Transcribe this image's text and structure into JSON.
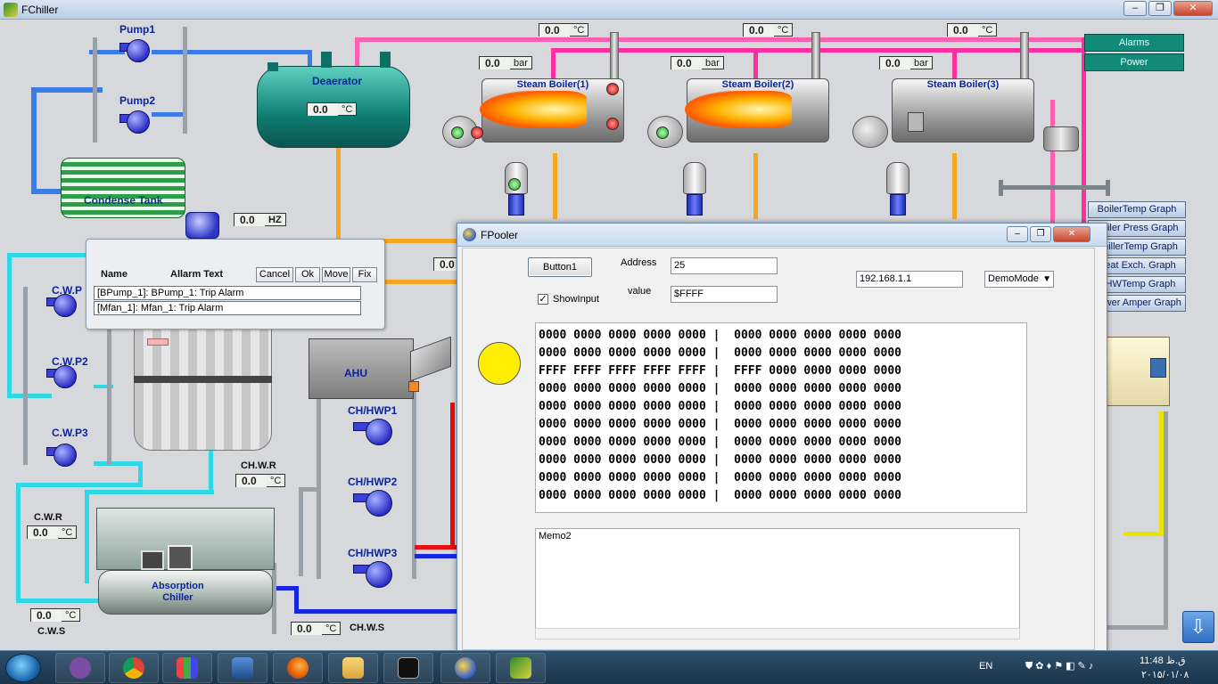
{
  "window": {
    "title": "FChiller",
    "min": "‒",
    "max": "❐",
    "close": "✕"
  },
  "canvas": {
    "pumps": {
      "pump1": "Pump1",
      "pump2": "Pump2",
      "cwp1": "C.W.P",
      "cwp2": "C.W.P2",
      "cwp3": "C.W.P3",
      "chwp1": "CH/HWP1",
      "chwp2": "CH/HWP2",
      "chwp3": "CH/HWP3"
    },
    "deaerator": {
      "label": "Deaerator",
      "value": "0.0",
      "unit": "°C"
    },
    "condense_tank": "Condense Tank",
    "hz_readout": {
      "value": "0.0",
      "unit": "HZ"
    },
    "boilers": [
      {
        "name": "Steam Boiler(1)",
        "temp": "0.0",
        "temp_unit": "°C",
        "press": "0.0",
        "press_unit": "bar"
      },
      {
        "name": "Steam Boiler(2)",
        "temp": "0.0",
        "temp_unit": "°C",
        "press": "0.0",
        "press_unit": "bar"
      },
      {
        "name": "Steam Boiler(3)",
        "temp": "0.0",
        "temp_unit": "°C",
        "press": "0.0",
        "press_unit": "bar"
      }
    ],
    "misc_readout": "0.0",
    "ahu": "AHU",
    "chwr": {
      "label": "CH.W.R",
      "value": "0.0",
      "unit": "°C"
    },
    "chws": {
      "label": "CH.W.S",
      "value": "0.0",
      "unit": "°C"
    },
    "cwr": {
      "label": "C.W.R",
      "value": "0.0",
      "unit": "°C"
    },
    "cws": {
      "label": "C.W.S",
      "value": "0.0",
      "unit": "°C"
    },
    "absorption": "Absorption\nChiller",
    "top_buttons": {
      "alarms": "Alarms",
      "power": "Power"
    },
    "graph_buttons": [
      "BoilerTemp Graph",
      "Boiler Press Graph",
      "ChillerTemp Graph",
      "Heat Exch. Graph",
      "CHWTemp Graph",
      "Power Amper Graph"
    ]
  },
  "alarm_panel": {
    "col_name": "Name",
    "col_text": "Allarm Text",
    "buttons": {
      "cancel": "Cancel",
      "ok": "Ok",
      "move": "Move",
      "fix": "Fix"
    },
    "rows": [
      "[BPump_1]: BPump_1: Trip Alarm",
      "[Mfan_1]: Mfan_1: Trip Alarm"
    ]
  },
  "pooler": {
    "title": "FPooler",
    "button1": "Button1",
    "showinput": "ShowInput",
    "address_label": "Address",
    "address_value": "25",
    "value_label": "value",
    "value_value": "$FFFF",
    "ip": "192.168.1.1",
    "mode": "DemoMode",
    "data_lines": [
      "0000 0000 0000 0000 0000 |  0000 0000 0000 0000 0000",
      "0000 0000 0000 0000 0000 |  0000 0000 0000 0000 0000",
      "FFFF FFFF FFFF FFFF FFFF |  FFFF 0000 0000 0000 0000",
      "0000 0000 0000 0000 0000 |  0000 0000 0000 0000 0000",
      "0000 0000 0000 0000 0000 |  0000 0000 0000 0000 0000",
      "0000 0000 0000 0000 0000 |  0000 0000 0000 0000 0000",
      "0000 0000 0000 0000 0000 |  0000 0000 0000 0000 0000",
      "0000 0000 0000 0000 0000 |  0000 0000 0000 0000 0000",
      "0000 0000 0000 0000 0000 |  0000 0000 0000 0000 0000",
      "0000 0000 0000 0000 0000 |  0000 0000 0000 0000 0000"
    ],
    "memo": "Memo2",
    "indicator_color": "#ffee00"
  },
  "taskbar": {
    "lang": "EN",
    "time": "11:48 ق.ظ",
    "date": "۲۰۱۵/۰۱/۰۸"
  }
}
